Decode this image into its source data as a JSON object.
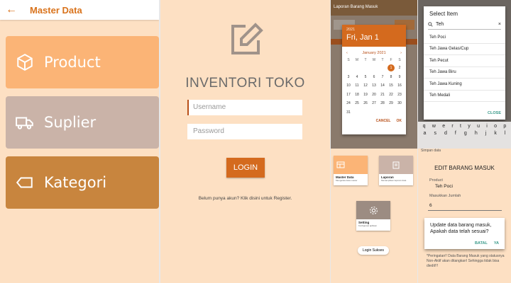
{
  "master": {
    "title": "Master Data",
    "cards": [
      {
        "label": "Product",
        "icon": "box-icon"
      },
      {
        "label": "Suplier",
        "icon": "truck-icon"
      },
      {
        "label": "Kategori",
        "icon": "tag-icon"
      }
    ]
  },
  "login": {
    "app_title": "INVENTORI TOKO",
    "username_placeholder": "Username",
    "password_placeholder": "Password",
    "login_label": "LOGIN",
    "register_text": "Belum punya akun? Klik disini untuk Register."
  },
  "calendar": {
    "bar_title": "Laporan Barang Masuk",
    "year": "2021",
    "date": "Fri, Jan 1",
    "month": "January 2021",
    "weekdays": [
      "S",
      "M",
      "T",
      "W",
      "T",
      "F",
      "S"
    ],
    "selected_day": 1,
    "cancel": "CANCEL",
    "ok": "OK",
    "menu": {
      "master": {
        "name": "Master Data",
        "sub": "Mengelola data master"
      },
      "laporan": {
        "name": "Laporan",
        "sub": "Menampilkan laporan data"
      },
      "setting": {
        "name": "Setting",
        "sub": "Konfigurasi aplikasi"
      }
    },
    "toast": "Login Sukses"
  },
  "select": {
    "title": "Select Item",
    "query": "Teh",
    "items": [
      "Teh Poci",
      "Teh Jawa Gelas/Cup",
      "Teh Pecut",
      "Teh Jawa Biru",
      "Teh Jawa Kuning",
      "Teh Medali"
    ],
    "close": "CLOSE",
    "keys1": [
      "q",
      "w",
      "e",
      "r",
      "t",
      "y",
      "u",
      "i",
      "o",
      "p"
    ],
    "keys2": [
      "a",
      "s",
      "d",
      "f",
      "g",
      "h",
      "j",
      "k",
      "l"
    ],
    "under_text": "Simpan data",
    "edit_title": "EDIT BARANG MASUK",
    "product_label": "Product",
    "product_value": "Teh Poci",
    "qty_label": "Masukkan Jumlah",
    "qty_value": "6",
    "confirm_msg": "Update data barang masuk, Apakah data telah sesuai?",
    "batal": "BATAL",
    "ya": "YA",
    "note": "*Peringatan!! Data Barang Masuk yang statusnya Non-Aktif akan ditangkan! Sehingga tidak bisa diedit!!!"
  },
  "colors": {
    "accent": "#d46a1e",
    "bg": "#fde0c3",
    "product": "#fbb476",
    "suplier": "#cab3a8",
    "kategori": "#c8853e"
  }
}
